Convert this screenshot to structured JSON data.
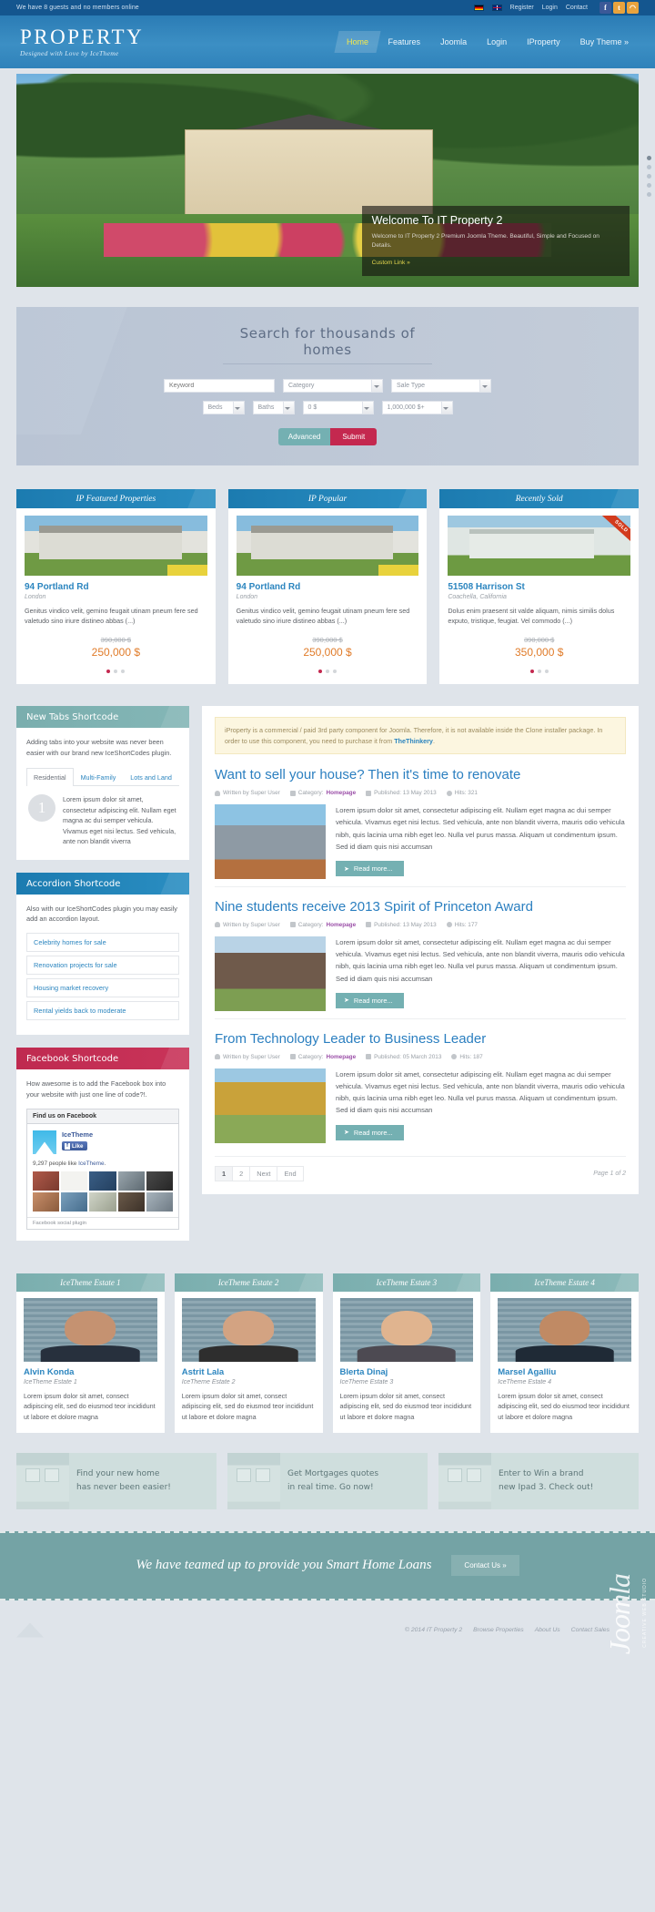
{
  "topbar": {
    "online_text": "We have 8 guests and no members online",
    "flags": [
      "flag-de",
      "flag-uk"
    ],
    "links": [
      "Register",
      "Login",
      "Contact"
    ],
    "social": [
      {
        "name": "facebook-icon",
        "glyph": "f",
        "color": "#3b5998"
      },
      {
        "name": "twitter-icon",
        "glyph": "t",
        "color": "#e8a33d"
      },
      {
        "name": "rss-icon",
        "glyph": "◠",
        "color": "#e8a33d"
      }
    ]
  },
  "header": {
    "logo_title": "PROPERTY",
    "logo_subtitle": "Designed with Love by IceTheme",
    "nav": [
      {
        "label": "Home",
        "active": true
      },
      {
        "label": "Features",
        "active": false
      },
      {
        "label": "Joomla",
        "active": false
      },
      {
        "label": "Login",
        "active": false
      },
      {
        "label": "IProperty",
        "active": false
      },
      {
        "label": "Buy Theme »",
        "active": false
      }
    ]
  },
  "hero": {
    "caption_title": "Welcome To IT Property 2",
    "caption_text": "Welcome to IT Property 2 Premium Joomla Theme. Beautiful, Simple and Focused on Details.",
    "caption_link": "Custom Link »",
    "dots": 5,
    "active_dot": 0
  },
  "search": {
    "title": "Search for thousands of homes",
    "keyword_placeholder": "Keyword",
    "category": "Category",
    "sale_type": "Sale Type",
    "beds": "Beds",
    "baths": "Baths",
    "price_min": "0 $",
    "price_max": "1,000,000 $+",
    "advanced_label": "Advanced",
    "submit_label": "Submit"
  },
  "properties": [
    {
      "module_title": "IP Featured Properties",
      "title": "94 Portland Rd",
      "location": "London",
      "desc": "Genitus vindico velit, gemino feugait utinam pneum fere sed valetudo sino iriure distineo abbas (...)",
      "old_price": "390,000 $",
      "new_price": "250,000 $",
      "sold": false,
      "img": "house1"
    },
    {
      "module_title": "IP Popular",
      "title": "94 Portland Rd",
      "location": "London",
      "desc": "Genitus vindico velit, gemino feugait utinam pneum fere sed valetudo sino iriure distineo abbas (...)",
      "old_price": "390,000 $",
      "new_price": "250,000 $",
      "sold": false,
      "img": "house1"
    },
    {
      "module_title": "Recently Sold",
      "title": "51508 Harrison St",
      "location": "Coachella, California",
      "desc": "Dolus enim praesent sit valde aliquam, nimis similis dolus exputo, tristique, feugiat. Vel commodo (...)",
      "old_price": "390,000 $",
      "new_price": "350,000 $",
      "sold": true,
      "sold_label": "SOLD",
      "img": "house3"
    }
  ],
  "sidebar": {
    "tabs_module": {
      "title": "New Tabs Shortcode",
      "intro": "Adding tabs into your website was never been easier with our brand new IceShortCodes plugin.",
      "tabs": [
        {
          "label": "Residential",
          "active": true
        },
        {
          "label": "Multi-Family",
          "active": false
        },
        {
          "label": "Lots and Land",
          "active": false
        }
      ],
      "number": "1",
      "panel_text": "Lorem ipsum dolor sit amet, consectetur adipiscing elit. Nullam eget magna ac dui semper vehicula. Vivamus eget nisi lectus. Sed vehicula, ante non blandit viverra"
    },
    "accordion_module": {
      "title": "Accordion Shortcode",
      "intro": "Also with our IceShortCodes plugin you may easily add an accordion layout.",
      "items": [
        "Celebrity homes for sale",
        "Renovation projects for sale",
        "Housing market recovery",
        "Rental yields back to moderate"
      ]
    },
    "facebook_module": {
      "title": "Facebook Shortcode",
      "intro": "How awesome is to add the Facebook box into your website with just one line of code?!.",
      "widget_header": "Find us on Facebook",
      "page_name": "IceTheme",
      "like_label": "Like",
      "count_text": "9,297 people like",
      "count_link": "IceTheme",
      "footer_text": "Facebook social plugin"
    }
  },
  "main": {
    "notice": "iProperty is a commercial / paid 3rd party component for Joomla. Therefore, it is not available inside the Clone installer package. In order to use this component, you need to purchase it from ",
    "notice_link": "TheThinkery",
    "articles": [
      {
        "title": "Want to sell your house? Then it's time to renovate",
        "author": "Written by Super User",
        "category_label": "Category:",
        "category": "Homepage",
        "published": "Published: 13 May 2013",
        "hits": "Hits: 321",
        "body": "Lorem ipsum dolor sit amet, consectetur adipiscing elit. Nullam eget magna ac dui semper vehicula. Vivamus eget nisi lectus. Sed vehicula, ante non blandit viverra, mauris odio vehicula nibh, quis lacinia urna nibh eget leo. Nulla vel purus massa. Aliquam ut condimentum ipsum. Sed id diam quis nisi accumsan",
        "read_more": "Read more...",
        "img": "a1"
      },
      {
        "title": "Nine students receive 2013 Spirit of Princeton Award",
        "author": "Written by Super User",
        "category_label": "Category:",
        "category": "Homepage",
        "published": "Published: 13 May 2013",
        "hits": "Hits: 177",
        "body": "Lorem ipsum dolor sit amet, consectetur adipiscing elit. Nullam eget magna ac dui semper vehicula. Vivamus eget nisi lectus. Sed vehicula, ante non blandit viverra, mauris odio vehicula nibh, quis lacinia urna nibh eget leo. Nulla vel purus massa. Aliquam ut condimentum ipsum. Sed id diam quis nisi accumsan",
        "read_more": "Read more...",
        "img": "a2"
      },
      {
        "title": "From Technology Leader to Business Leader",
        "author": "Written by Super User",
        "category_label": "Category:",
        "category": "Homepage",
        "published": "Published: 05 March 2013",
        "hits": "Hits: 187",
        "body": "Lorem ipsum dolor sit amet, consectetur adipiscing elit. Nullam eget magna ac dui semper vehicula. Vivamus eget nisi lectus. Sed vehicula, ante non blandit viverra, mauris odio vehicula nibh, quis lacinia urna nibh eget leo. Nulla vel purus massa. Aliquam ut condimentum ipsum. Sed id diam quis nisi accumsan",
        "read_more": "Read more...",
        "img": "a3"
      }
    ],
    "pagination": {
      "buttons": [
        "1",
        "2",
        "Next",
        "End"
      ],
      "active": "1",
      "page_info": "Page 1 of 2"
    }
  },
  "agents": [
    {
      "module_title": "IceTheme Estate 1",
      "name": "Alvin Konda",
      "role": "IceTheme Estate 1",
      "desc": "Lorem ipsum dolor sit amet, consect adipiscing elit, sed do eiusmod teor incididunt ut labore et dolore magna",
      "photo": "p1"
    },
    {
      "module_title": "IceTheme Estate 2",
      "name": "Astrit Lala",
      "role": "IceTheme Estate 2",
      "desc": "Lorem ipsum dolor sit amet, consect adipiscing elit, sed do eiusmod teor incididunt ut labore et dolore magna",
      "photo": "p2"
    },
    {
      "module_title": "IceTheme Estate 3",
      "name": "Blerta Dinaj",
      "role": "IceTheme Estate 3",
      "desc": "Lorem ipsum dolor sit amet, consect adipiscing elit, sed do eiusmod teor incididunt ut labore et dolore magna",
      "photo": "p3"
    },
    {
      "module_title": "IceTheme Estate 4",
      "name": "Marsel Agalliu",
      "role": "IceTheme Estate 4",
      "desc": "Lorem ipsum dolor sit amet, consect adipiscing elit, sed do eiusmod teor incididunt ut labore et dolore magna",
      "photo": "p4"
    }
  ],
  "promos": [
    {
      "line1": "Find your new home",
      "line2": "has never been easier!"
    },
    {
      "line1": "Get Mortgages quotes",
      "line2": "in real time. Go now!"
    },
    {
      "line1": "Enter to Win a brand",
      "line2": "new Ipad 3. Check out!"
    }
  ],
  "cta": {
    "text": "We have teamed up to provide you Smart Home Loans",
    "button": "Contact Us »"
  },
  "footer": {
    "copyright": "© 2014 IT Property 2",
    "links": [
      "Browse Properties",
      "About Us",
      "Contact Sales"
    ],
    "watermark": "Joomla",
    "watermark_sub": "CREATIVE WEB STUDIO"
  },
  "colors": {
    "brand_blue": "#2b7cb5",
    "dark_blue": "#14568f",
    "teal": "#74b0b2",
    "pink": "#c4284f",
    "orange": "#e07b29",
    "page_bg": "#dfe4ea"
  }
}
